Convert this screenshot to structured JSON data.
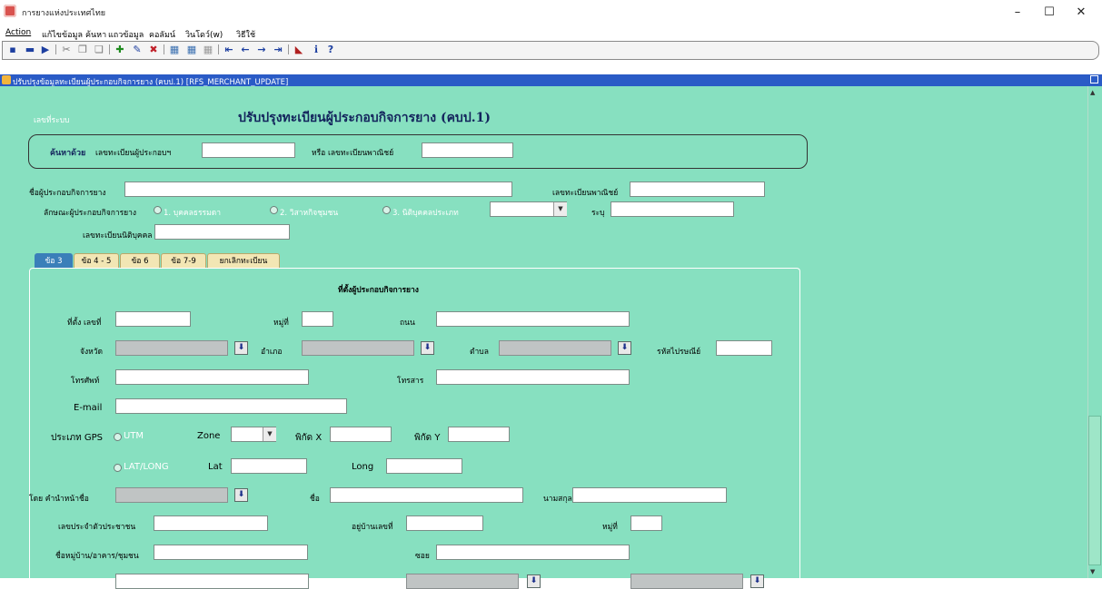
{
  "window": {
    "title": "การยางแห่งประเทศไทย",
    "min_label": "–",
    "max_label": "☐",
    "close_label": "✕"
  },
  "menu": [
    "Action",
    "แก้ไข",
    "ข้อมูล",
    "ค้นหา",
    "แถวข้อมูล",
    "คอลัมน์",
    "วินโดว์(w)",
    "วิธีใช้"
  ],
  "toolbar_icons": [
    "save-icon",
    "print-icon",
    "exit-icon",
    "cut-icon",
    "copy-icon",
    "paste-icon",
    "insert-record-icon",
    "edit-icon",
    "delete-record-icon",
    "query-enter-icon",
    "query-execute-icon",
    "query-cancel-icon",
    "first-record-icon",
    "previous-record-icon",
    "next-record-icon",
    "last-record-icon",
    "chart-icon",
    "info-icon",
    "help-icon"
  ],
  "toolbar_glyphs": {
    "first": "⇤",
    "prev": "←",
    "next": "→",
    "last": "⇥",
    "info": "ℹ",
    "help": "?"
  },
  "inner_window": {
    "title": "ปรับปรุงข้อมูลทะเบียนผู้ประกอบกิจการยาง (คบป.1) [RFS_MERCHANT_UPDATE]"
  },
  "form": {
    "system_no_label": "เลขที่ระบบ",
    "title": "ปรับปรุงทะเบียนผู้ประกอบกิจการยาง (คบป.1)",
    "search": {
      "label": "ค้นหาด้วย",
      "reg_no_label": "เลขทะเบียนผู้ประกอบฯ",
      "reg_no_value": "",
      "or_label": "หรือ เลขทะเบียนพาณิชย์",
      "commerce_no_value": ""
    },
    "operator_name_label": "ชื่อผู้ประกอบกิจการยาง",
    "operator_name_value": "",
    "commerce_reg_label": "เลขทะเบียนพาณิชย์",
    "commerce_reg_value": "",
    "operator_type_label": "ลักษณะผู้ประกอบกิจการยาง",
    "operator_type_options": [
      "1. บุคคลธรรมดา",
      "2. วิสาหกิจชุมชน",
      "3. นิติบุคคลประเภท"
    ],
    "juristic_type_value": "",
    "specify_label": "ระบุ",
    "specify_value": "",
    "juristic_reg_label": "เลขทะเบียนนิติบุคคล",
    "juristic_reg_value": ""
  },
  "tabs": [
    "ข้อ 3",
    "ข้อ 4 - 5",
    "ข้อ 6",
    "ข้อ 7-9",
    "ยกเลิกทะเบียน"
  ],
  "tab3": {
    "section_title": "ที่ตั้งผู้ประกอบกิจการยาง",
    "address_no_label": "ที่ตั้ง เลขที่",
    "moo_label": "หมู่ที่",
    "road_label": "ถนน",
    "province_label": "จังหวัด",
    "district_label": "อำเภอ",
    "subdistrict_label": "ตำบล",
    "postcode_label": "รหัสไปรษณีย์",
    "phone_label": "โทรศัพท์",
    "fax_label": "โทรสาร",
    "email_label": "E-mail",
    "gps_type_label": "ประเภท GPS",
    "utm_label": "UTM",
    "zone_label": "Zone",
    "x_label": "พิกัด X",
    "y_label": "พิกัด Y",
    "latlong_label": "LAT/LONG",
    "lat_label": "Lat",
    "long_label": "Long",
    "prefix_label": "โดย คำนำหน้าชื่อ",
    "first_name_label": "ชื่อ",
    "last_name_label": "นามสกุล",
    "id_card_label": "เลขประจำตัวประชาชน",
    "house_no_label": "อยู่บ้านเลขที่",
    "moo2_label": "หมู่ที่",
    "village_label": "ชื่อหมู่บ้าน/อาคาร/ชุมชน",
    "soi_label": "ซอย",
    "lov_glyph": "⬇",
    "combo_glyph": "▼"
  },
  "colors": {
    "form_bg": "#87e0c0",
    "title_bar_blue": "#2a5bc6",
    "active_tab": "#3a7fb9",
    "inactive_tab": "#f2e6b4",
    "title_text": "#13245c"
  }
}
